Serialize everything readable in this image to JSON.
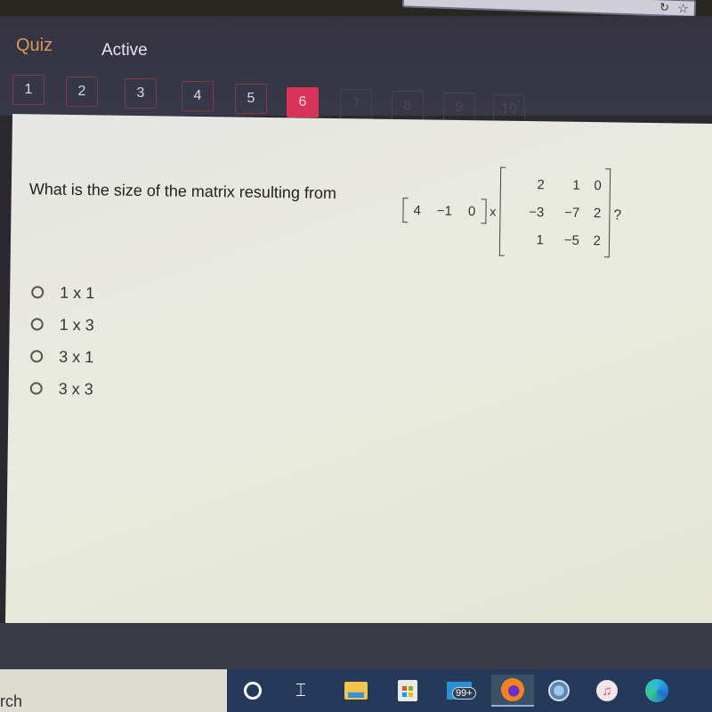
{
  "browser": {
    "star_icon": "star-icon",
    "refresh_icon": "refresh-icon"
  },
  "header": {
    "title": "Quiz",
    "status": "Active",
    "title_color": "#d99a5a"
  },
  "question_tabs": [
    {
      "label": "1",
      "state": "visited"
    },
    {
      "label": "2",
      "state": "visited"
    },
    {
      "label": "3",
      "state": "visited"
    },
    {
      "label": "4",
      "state": "visited"
    },
    {
      "label": "5",
      "state": "visited"
    },
    {
      "label": "6",
      "state": "current"
    },
    {
      "label": "7",
      "state": "unvisited"
    },
    {
      "label": "8",
      "state": "unvisited"
    },
    {
      "label": "9",
      "state": "unvisited"
    },
    {
      "label": "10",
      "state": "unvisited"
    }
  ],
  "accent_color": "#d8345a",
  "question": {
    "text": "What is the size of the matrix resulting from",
    "row_vector": [
      "4",
      "−1",
      "0"
    ],
    "operator": "x",
    "matrix": [
      [
        "2",
        "1",
        "0"
      ],
      [
        "−3",
        "−7",
        "2"
      ],
      [
        "1",
        "−5",
        "2"
      ]
    ],
    "end_mark": "?"
  },
  "options": [
    {
      "label": "1 x 1",
      "selected": false
    },
    {
      "label": "1 x 3",
      "selected": false
    },
    {
      "label": "3 x 1",
      "selected": false
    },
    {
      "label": "3 x 3",
      "selected": false
    }
  ],
  "taskbar": {
    "search_text": "rch",
    "icons": [
      "cortana-icon",
      "task-view-icon",
      "file-explorer-icon",
      "microsoft-store-icon",
      "mail-icon",
      "firefox-icon",
      "globe-app-icon",
      "itunes-icon",
      "edge-icon"
    ],
    "mail_badge": "99+",
    "task_view_glyph": "⌶",
    "itunes_glyph": "♫"
  }
}
